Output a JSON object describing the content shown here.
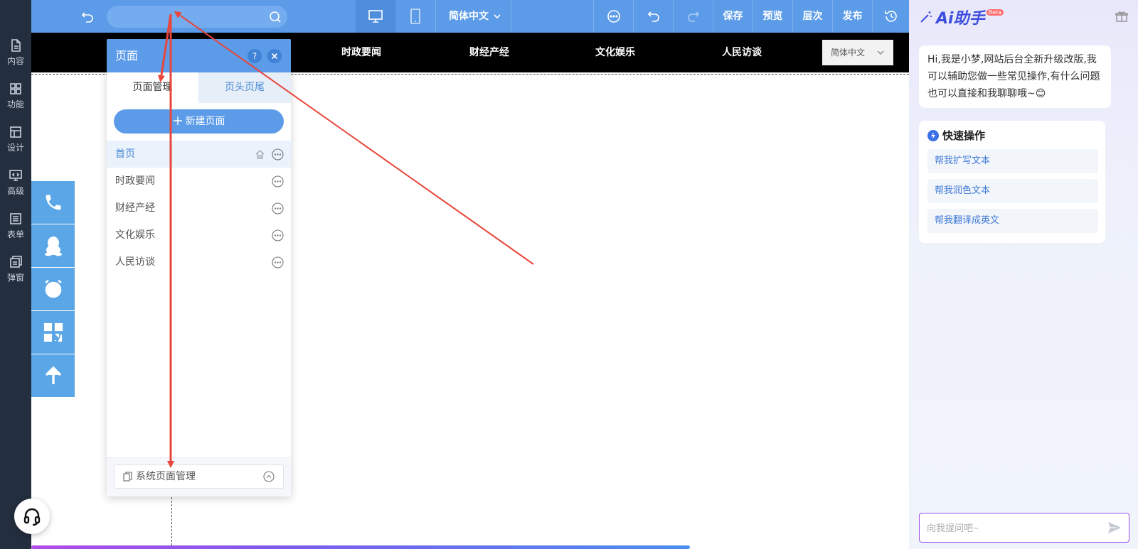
{
  "toolbar": {
    "search_placeholder": "",
    "language": "简体中文",
    "save_label": "保存",
    "preview_label": "预览",
    "layers_label": "层次",
    "publish_label": "发布"
  },
  "sidebar": {
    "items": [
      {
        "label": "内容",
        "icon": "document-icon"
      },
      {
        "label": "功能",
        "icon": "grid-icon"
      },
      {
        "label": "设计",
        "icon": "layout-icon"
      },
      {
        "label": "高级",
        "icon": "code-monitor-icon"
      },
      {
        "label": "表单",
        "icon": "list-icon"
      },
      {
        "label": "弹窗",
        "icon": "popup-icon"
      }
    ]
  },
  "site_nav": {
    "links": [
      "时政要闻",
      "财经产经",
      "文化娱乐",
      "人民访谈"
    ],
    "language": "简体中文"
  },
  "page_panel": {
    "title": "页面",
    "help_label": "?",
    "tabs": [
      "页面管理",
      "页头页尾"
    ],
    "new_page_label": "新建页面",
    "pages": [
      "首页",
      "时政要闻",
      "财经产经",
      "文化娱乐",
      "人民访谈"
    ],
    "system_pages_label": "系统页面管理"
  },
  "ai": {
    "title": "Ai助手",
    "badge": "Beta",
    "message": "Hi,我是小梦,网站后台全新升级改版,我可以辅助您做一些常见操作,有什么问题也可以直接和我聊聊哦~😊",
    "quick_title": "快速操作",
    "quick_actions": [
      "帮我扩写文本",
      "帮我润色文本",
      "帮我翻译成英文"
    ],
    "input_placeholder": "向我提问吧~"
  },
  "progress": {
    "fraction": 0.75
  },
  "colors": {
    "toolbar": "#5b9be8",
    "sidebar": "#232e3e",
    "float_buttons": "#5aa6e6",
    "arrow": "#e8463c",
    "ai_accent": "#3d4de0"
  }
}
